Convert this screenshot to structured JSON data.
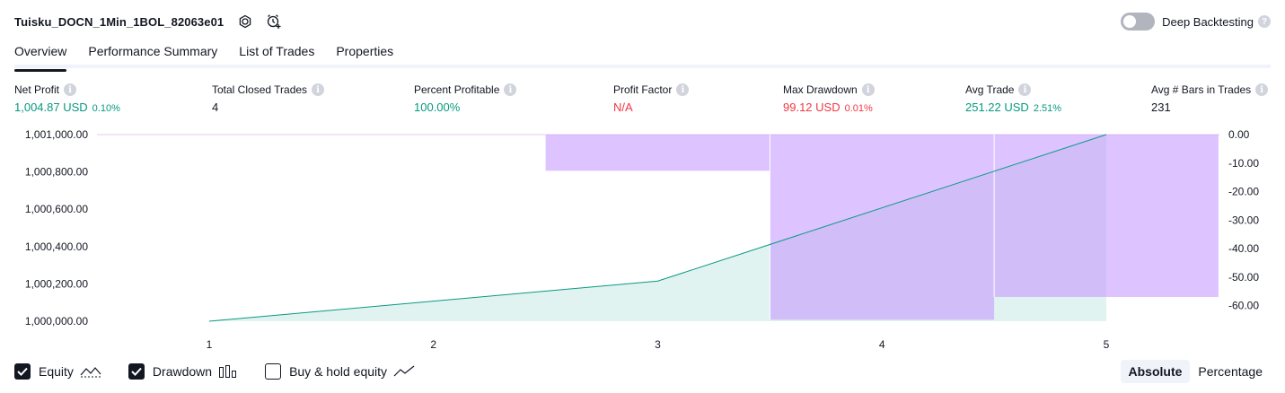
{
  "header": {
    "strategy_name": "Tuisku_DOCN_1Min_1BOL_82063e01",
    "deep_backtesting_label": "Deep Backtesting",
    "deep_backtesting_enabled": false
  },
  "tabs": [
    {
      "label": "Overview",
      "active": true
    },
    {
      "label": "Performance Summary",
      "active": false
    },
    {
      "label": "List of Trades",
      "active": false
    },
    {
      "label": "Properties",
      "active": false
    }
  ],
  "metrics": [
    {
      "label": "Net Profit",
      "value": "1,004.87 USD",
      "pct": "0.10%",
      "color": "green"
    },
    {
      "label": "Total Closed Trades",
      "value": "4",
      "pct": "",
      "color": "dark"
    },
    {
      "label": "Percent Profitable",
      "value": "100.00%",
      "pct": "",
      "color": "green"
    },
    {
      "label": "Profit Factor",
      "value": "N/A",
      "pct": "",
      "color": "red"
    },
    {
      "label": "Max Drawdown",
      "value": "99.12 USD",
      "pct": "0.01%",
      "color": "red"
    },
    {
      "label": "Avg Trade",
      "value": "251.22 USD",
      "pct": "2.51%",
      "color": "green"
    },
    {
      "label": "Avg # Bars in Trades",
      "value": "231",
      "pct": "",
      "color": "dark"
    }
  ],
  "chart_data": {
    "type": "area",
    "x": [
      1,
      2,
      3,
      4,
      5
    ],
    "left_axis_ticks": [
      "1,001,000.00",
      "1,000,800.00",
      "1,000,600.00",
      "1,000,400.00",
      "1,000,200.00",
      "1,000,000.00"
    ],
    "right_axis_ticks": [
      "0.00",
      "-10.00",
      "-20.00",
      "-30.00",
      "-40.00",
      "-50.00",
      "-60.00"
    ],
    "x_ticks": [
      "1",
      "2",
      "3",
      "4",
      "5"
    ],
    "ylim_left": [
      1000000,
      1001000
    ],
    "ylim_right": [
      -65,
      0
    ],
    "series": [
      {
        "name": "Equity",
        "color": "#089981",
        "points": [
          [
            1,
            1000000
          ],
          [
            3,
            1000215
          ],
          [
            5,
            1001000
          ]
        ]
      },
      {
        "name": "Drawdown",
        "color": "#c79bff",
        "bars": [
          {
            "x_from": 2.5,
            "x_to": 3.5,
            "value": -12.7
          },
          {
            "x_from": 3.5,
            "x_to": 4.5,
            "value": -65
          },
          {
            "x_from": 4.5,
            "x_to": 5.5,
            "value": -57
          }
        ]
      }
    ]
  },
  "legend": [
    {
      "label": "Equity",
      "checked": true,
      "icon": "equity-line-icon"
    },
    {
      "label": "Drawdown",
      "checked": true,
      "icon": "drawdown-bars-icon"
    },
    {
      "label": "Buy & hold equity",
      "checked": false,
      "icon": "buy-hold-line-icon"
    }
  ],
  "scale_switch": {
    "absolute": "Absolute",
    "percentage": "Percentage",
    "active": "absolute"
  }
}
